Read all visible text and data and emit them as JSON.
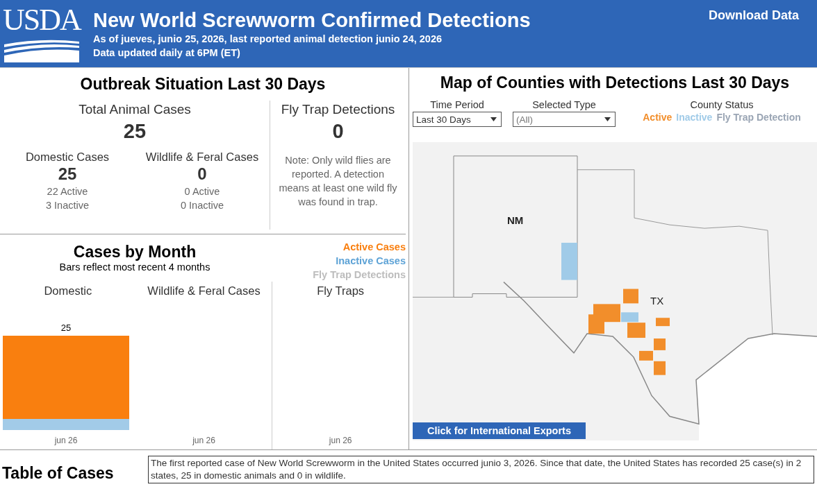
{
  "header": {
    "logo": "USDA",
    "title": "New World Screwworm Confirmed Detections",
    "subtitle": "As of jueves, junio 25, 2026, last reported animal detection junio 24, 2026",
    "updated": "Data updated daily at 6PM (ET)",
    "download": "Download Data"
  },
  "outbreak": {
    "title": "Outbreak Situation Last 30 Days",
    "total": {
      "label": "Total Animal Cases",
      "value": "25"
    },
    "groups": [
      {
        "label": "Domestic Cases",
        "value": "25",
        "active": "22 Active",
        "inactive": "3 Inactive"
      },
      {
        "label": "Wildlife & Feral Cases",
        "value": "0",
        "active": "0 Active",
        "inactive": "0 Inactive"
      }
    ],
    "fly_trap": {
      "label": "Fly Trap Detections",
      "value": "0",
      "note": "Note: Only wild flies are reported. A detection means at least one wild fly was found in trap."
    }
  },
  "cases_by_month": {
    "title": "Cases by Month",
    "subtitle": "Bars reflect most recent 4 months",
    "legend": [
      {
        "label": "Active Cases",
        "color": "#f97f0f"
      },
      {
        "label": "Inactive Cases",
        "color": "#5ea3d6"
      },
      {
        "label": "Fly Trap Detections",
        "color": "#bdbdbd"
      }
    ],
    "panels": [
      {
        "title": "Domestic",
        "bar_label": "25",
        "x_label": "jun 26"
      },
      {
        "title": "Wildlife & Feral Cases",
        "x_label": "jun 26"
      },
      {
        "title": "Fly Traps",
        "x_label": "jun 26"
      }
    ]
  },
  "map": {
    "title": "Map of Counties with Detections Last 30 Days",
    "filters": [
      {
        "label": "Time Period",
        "value": "Last 30 Days",
        "muted": false
      },
      {
        "label": "Selected Type",
        "value": "(All)",
        "muted": true
      }
    ],
    "status_title": "County Status",
    "status_legend": [
      {
        "label": "Active",
        "color": "#f28e2b"
      },
      {
        "label": "Inactive",
        "color": "#a0cbe8"
      },
      {
        "label": "Fly Trap Detection",
        "color": "#9aa5b4"
      }
    ],
    "state_labels": [
      "NM",
      "TX"
    ],
    "export_button": "Click for International Exports"
  },
  "table": {
    "title": "Table of Cases",
    "note": "The first reported case of New World Screwworm in the United States occurred junio 3, 2026. Since that date, the United States has recorded 25 case(s) in 2 states, 25 in domestic animals and 0 in wildlife."
  }
}
